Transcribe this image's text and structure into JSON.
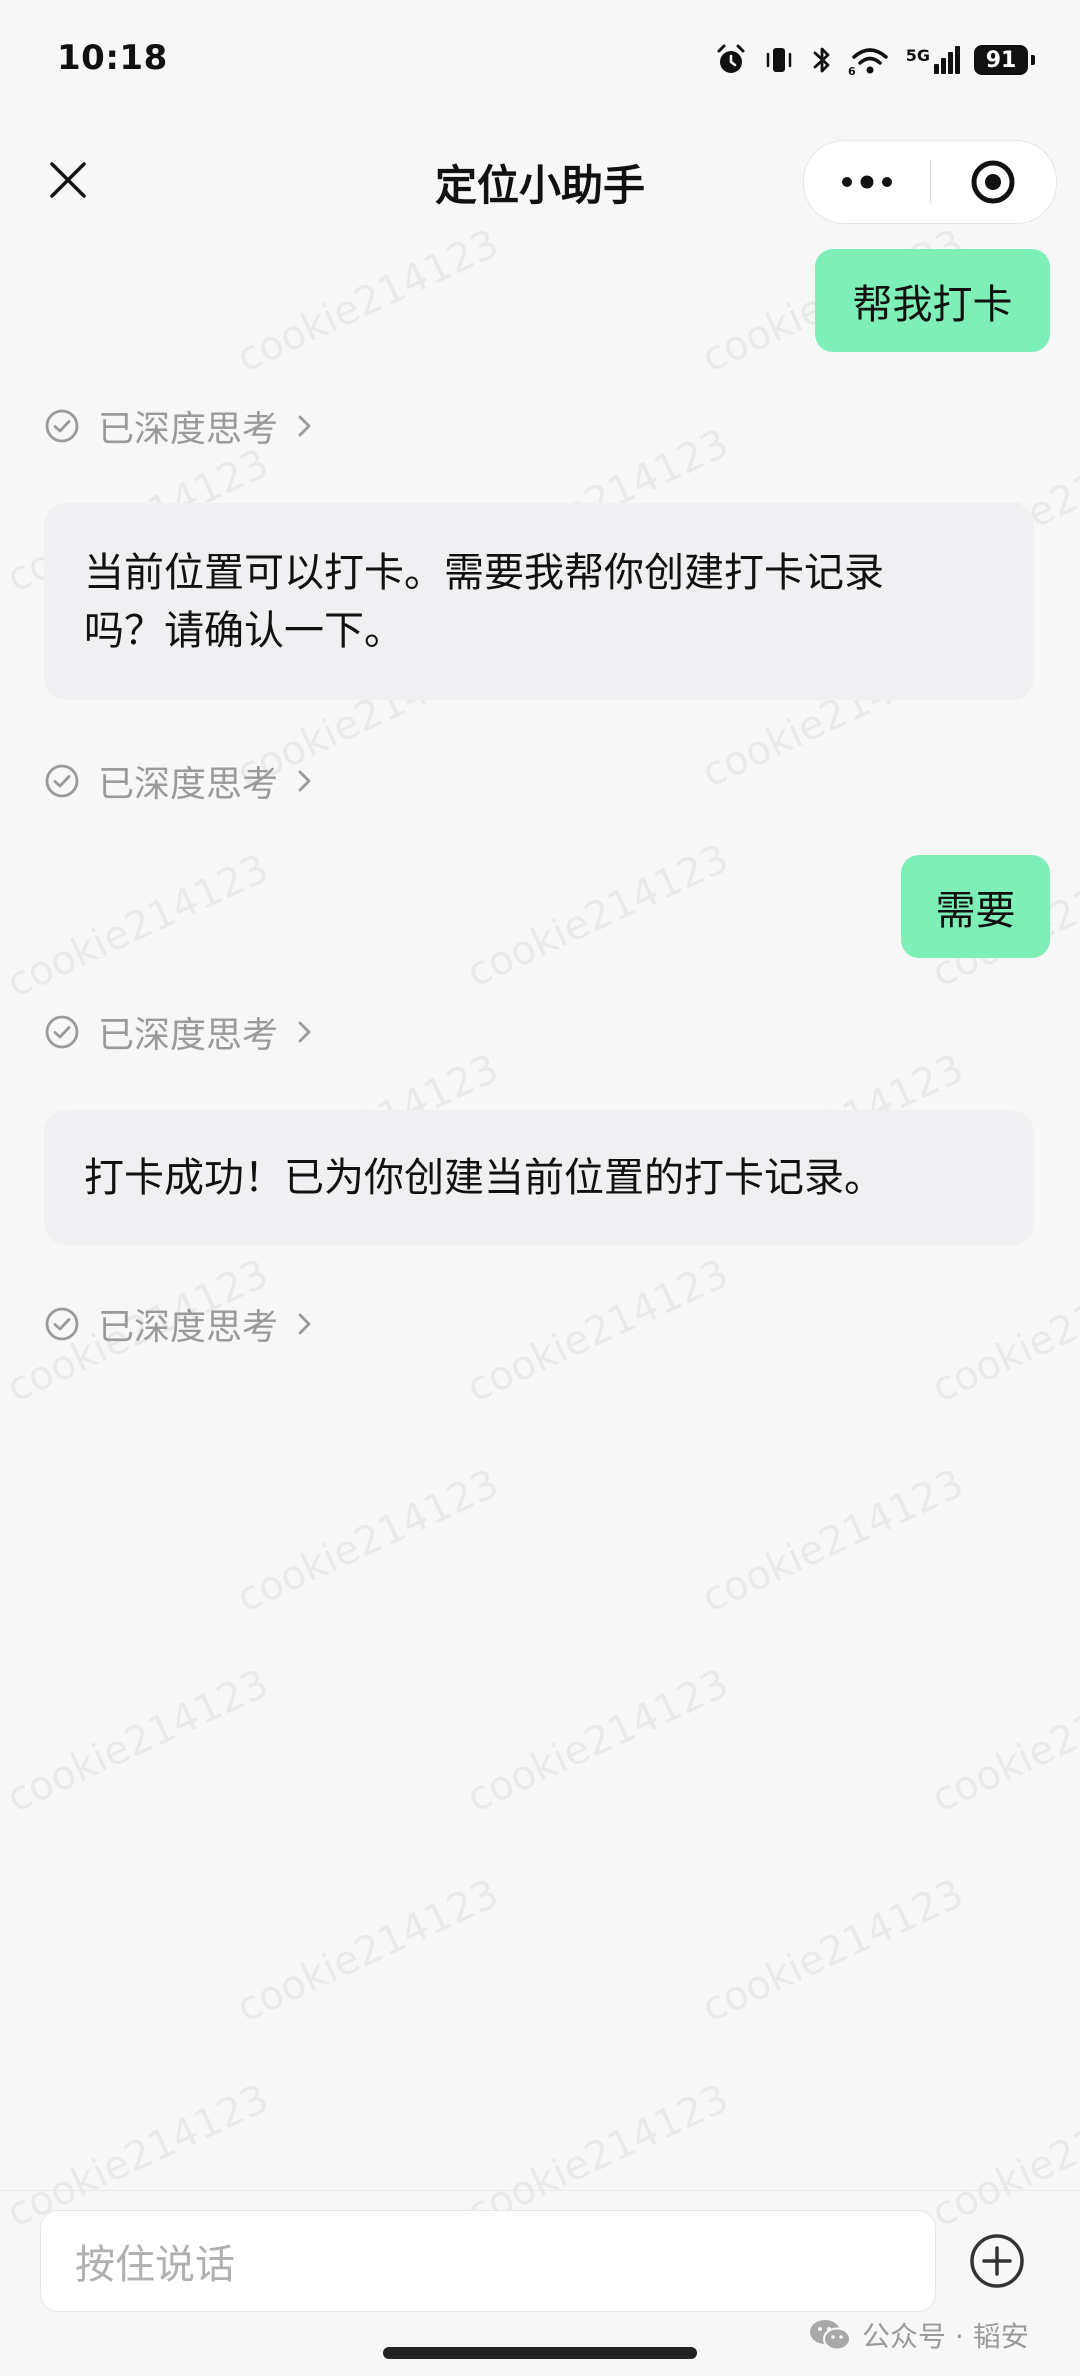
{
  "status_bar": {
    "time": "10:18",
    "network": "5G",
    "battery": "91",
    "icons": [
      "alarm-icon",
      "vibrate-icon",
      "bluetooth-icon",
      "wifi-icon",
      "signal-icon",
      "battery-icon"
    ]
  },
  "nav": {
    "title": "定位小助手",
    "icons": [
      "close-icon",
      "more-icon",
      "target-icon"
    ]
  },
  "messages": {
    "user_1": "帮我打卡",
    "thought_1": "已深度思考",
    "bot_1_line1": "当前位置可以打卡。需要我帮你创建打卡记录",
    "bot_1_line2": "吗？请确认一下。",
    "thought_2": "已深度思考",
    "user_2": "需要",
    "thought_3": "已深度思考",
    "bot_2": "打卡成功！已为你创建当前位置的打卡记录。",
    "thought_4": "已深度思考"
  },
  "watermark": "cookie214123",
  "bottom": {
    "voice_placeholder": "按住说话",
    "source_label": "公众号 · 韬安"
  },
  "colors": {
    "user_bubble": "#7ef0b7",
    "bot_bubble": "#f0f0f2",
    "background": "#f7f7f8"
  }
}
